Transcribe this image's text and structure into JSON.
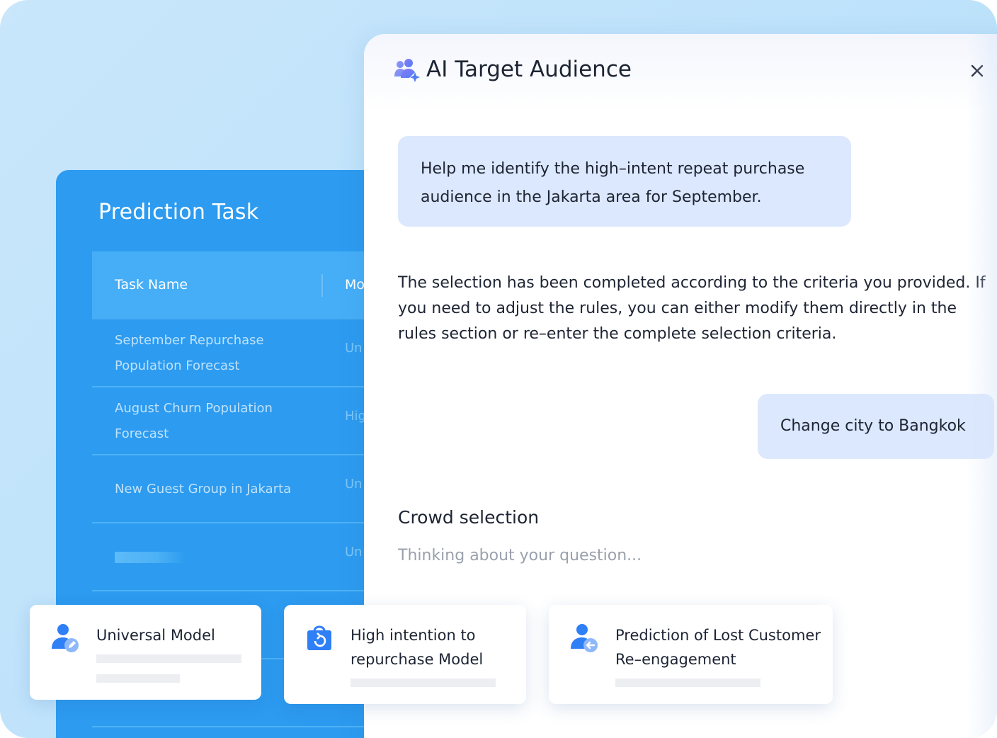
{
  "prediction_task": {
    "title": "Prediction Task",
    "columns": [
      "Task Name",
      "Mo"
    ],
    "rows": [
      {
        "name": "September Repurchase Population Forecast",
        "model": "Un"
      },
      {
        "name": "August Churn Population Forecast",
        "model": "Hig"
      },
      {
        "name": "New Guest Group in Jakarta",
        "model": "Un"
      },
      {
        "name": "",
        "model": "Un"
      }
    ]
  },
  "ai_panel": {
    "title": "AI Target Audience",
    "close_icon": "close-icon",
    "messages": {
      "user_1": "Help me identify the high–intent repeat purchase audience in the Jakarta area for September.",
      "assistant_1": "The selection has been completed according to the criteria you provided. If you need to adjust the rules, you can either modify them directly in the rules section or re–enter the complete selection criteria.",
      "user_2": "Change city to Bangkok"
    },
    "crowd_selection_title": "Crowd selection",
    "thinking_text": "Thinking about your question..."
  },
  "model_cards": [
    {
      "label": "Universal Model",
      "icon": "user-edit-icon"
    },
    {
      "label": "High intention to repurchase Model",
      "icon": "shopping-bag-icon"
    },
    {
      "label": "Prediction of Lost Customer Re–engagement",
      "icon": "user-return-icon"
    }
  ],
  "colors": {
    "task_panel": "#2c9bf0",
    "user_bubble": "#dce8fd",
    "icon_blue": "#2f7ff6"
  }
}
